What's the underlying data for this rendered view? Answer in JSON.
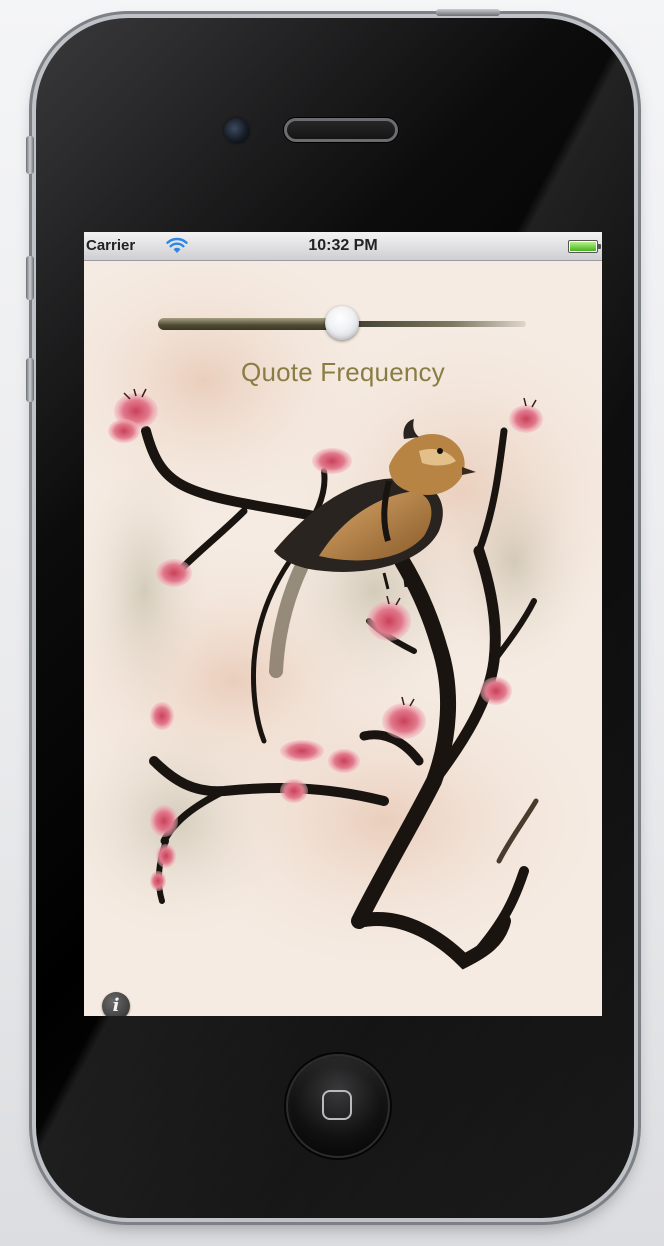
{
  "status_bar": {
    "carrier": "Carrier",
    "time": "10:32 PM",
    "wifi_icon": "wifi-icon",
    "battery_icon": "battery-icon",
    "battery_level": 1.0
  },
  "frequency_slider": {
    "label": "Quote Frequency",
    "value": 0.5
  },
  "info_button": {
    "glyph": "i",
    "icon": "info-icon"
  },
  "colors": {
    "label_olive": "#8a7d44",
    "blossom_pink": "#e27a8c",
    "ink_black": "#1a1411",
    "bird_ochre": "#b88444",
    "paper": "#f3e6dc"
  }
}
